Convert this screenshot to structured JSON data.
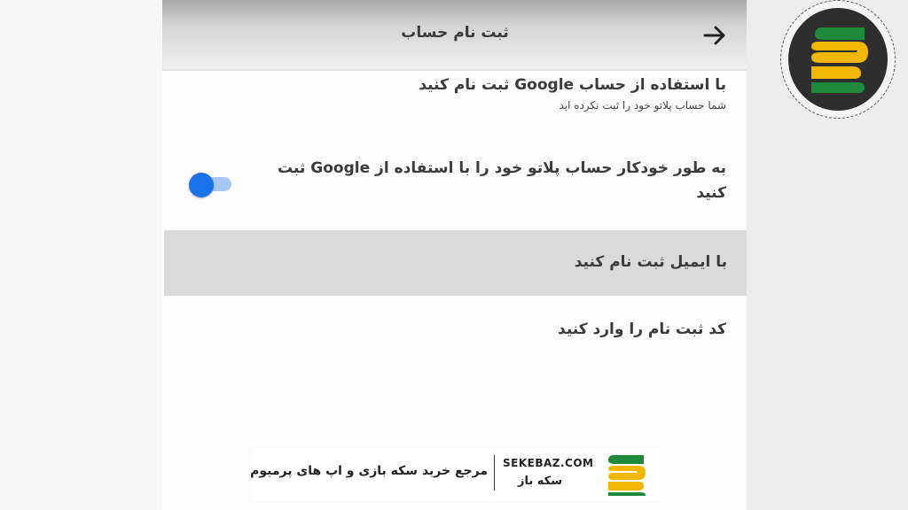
{
  "appbar": {
    "title": "ثبت نام حساب",
    "back_icon": "arrow-right-icon"
  },
  "google_signup": {
    "title": "با استفاده از حساب Google ثبت نام کنید",
    "subtitle": "شما حساب پلاتو خود را ثبت نکرده اید"
  },
  "auto_signup": {
    "label": "به طور خودکار حساب پلاتو خود را با استفاده از Google ثبت کنید",
    "toggle_on": true
  },
  "email_signup": {
    "label": "با ایمیل ثبت نام کنید"
  },
  "code_entry": {
    "label": "کد ثبت نام را وارد کنید"
  },
  "watermark": {
    "tagline": "مرجع خرید سکه بازی و اپ های پرمیوم",
    "domain": "SEKEBAZ.COM",
    "brand": "سکه باز"
  },
  "colors": {
    "accent": "#1a73e8",
    "logo_green": "#1f8a3b",
    "logo_yellow": "#f2b705",
    "logo_dark": "#2e2e2e"
  }
}
